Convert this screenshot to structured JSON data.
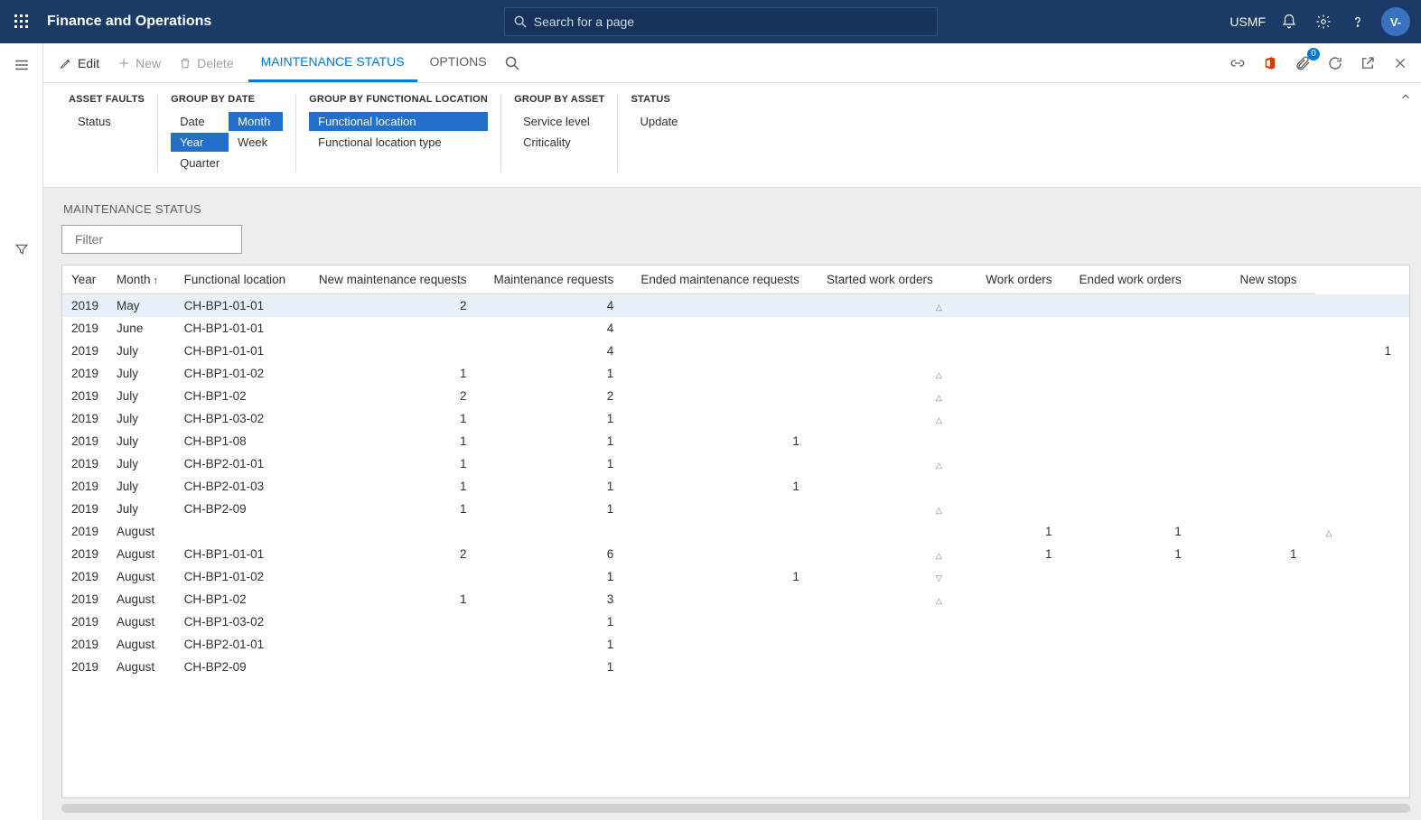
{
  "header": {
    "app_title": "Finance and Operations",
    "search_placeholder": "Search for a page",
    "company": "USMF",
    "avatar_initials": "V-"
  },
  "cmdbar": {
    "edit": "Edit",
    "new": "New",
    "delete": "Delete",
    "tabs": [
      "MAINTENANCE STATUS",
      "OPTIONS"
    ],
    "active_tab_index": 0,
    "attach_badge": "0"
  },
  "groups": {
    "asset_faults": {
      "title": "ASSET FAULTS",
      "items": [
        {
          "label": "Status",
          "selected": false
        }
      ]
    },
    "group_by_date": {
      "title": "GROUP BY DATE",
      "grid": [
        {
          "label": "Date",
          "selected": false
        },
        {
          "label": "Month",
          "selected": true
        },
        {
          "label": "Year",
          "selected": true
        },
        {
          "label": "Week",
          "selected": false
        },
        {
          "label": "Quarter",
          "selected": false
        }
      ]
    },
    "group_by_functional_location": {
      "title": "GROUP BY FUNCTIONAL LOCATION",
      "items": [
        {
          "label": "Functional location",
          "selected": true
        },
        {
          "label": "Functional location type",
          "selected": false
        }
      ]
    },
    "group_by_asset": {
      "title": "GROUP BY ASSET",
      "items": [
        {
          "label": "Service level",
          "selected": false
        },
        {
          "label": "Criticality",
          "selected": false
        }
      ]
    },
    "status": {
      "title": "STATUS",
      "items": [
        {
          "label": "Update",
          "selected": false
        }
      ]
    }
  },
  "section_title": "MAINTENANCE STATUS",
  "filter_placeholder": "Filter",
  "columns": [
    "Year",
    "Month",
    "Functional location",
    "New maintenance requests",
    "Maintenance requests",
    "Ended maintenance requests",
    "Started work orders",
    "Work orders",
    "Ended work orders",
    "New stops"
  ],
  "sort_col_index": 1,
  "rows": [
    {
      "year": "2019",
      "month": "May",
      "loc": "CH-BP1-01-01",
      "new_req": "2",
      "m_req": "4",
      "ended_req": "",
      "ended_ind": "up",
      "started_wo": "",
      "wo": "",
      "ended_wo": "",
      "ended_wo_ind": "",
      "stops": "",
      "selected": true
    },
    {
      "year": "2019",
      "month": "June",
      "loc": "CH-BP1-01-01",
      "new_req": "",
      "m_req": "4",
      "ended_req": "",
      "ended_ind": "",
      "started_wo": "",
      "wo": "",
      "ended_wo": "",
      "ended_wo_ind": "",
      "stops": ""
    },
    {
      "year": "2019",
      "month": "July",
      "loc": "CH-BP1-01-01",
      "new_req": "",
      "m_req": "4",
      "ended_req": "",
      "ended_ind": "",
      "started_wo": "",
      "wo": "",
      "ended_wo": "",
      "ended_wo_ind": "",
      "stops": "1"
    },
    {
      "year": "2019",
      "month": "July",
      "loc": "CH-BP1-01-02",
      "new_req": "1",
      "m_req": "1",
      "ended_req": "",
      "ended_ind": "up",
      "started_wo": "",
      "wo": "",
      "ended_wo": "",
      "ended_wo_ind": "",
      "stops": ""
    },
    {
      "year": "2019",
      "month": "July",
      "loc": "CH-BP1-02",
      "new_req": "2",
      "m_req": "2",
      "ended_req": "",
      "ended_ind": "up",
      "started_wo": "",
      "wo": "",
      "ended_wo": "",
      "ended_wo_ind": "",
      "stops": ""
    },
    {
      "year": "2019",
      "month": "July",
      "loc": "CH-BP1-03-02",
      "new_req": "1",
      "m_req": "1",
      "ended_req": "",
      "ended_ind": "up",
      "started_wo": "",
      "wo": "",
      "ended_wo": "",
      "ended_wo_ind": "",
      "stops": ""
    },
    {
      "year": "2019",
      "month": "July",
      "loc": "CH-BP1-08",
      "new_req": "1",
      "m_req": "1",
      "ended_req": "1",
      "ended_ind": "",
      "started_wo": "",
      "wo": "",
      "ended_wo": "",
      "ended_wo_ind": "",
      "stops": ""
    },
    {
      "year": "2019",
      "month": "July",
      "loc": "CH-BP2-01-01",
      "new_req": "1",
      "m_req": "1",
      "ended_req": "",
      "ended_ind": "up",
      "started_wo": "",
      "wo": "",
      "ended_wo": "",
      "ended_wo_ind": "",
      "stops": ""
    },
    {
      "year": "2019",
      "month": "July",
      "loc": "CH-BP2-01-03",
      "new_req": "1",
      "m_req": "1",
      "ended_req": "1",
      "ended_ind": "",
      "started_wo": "",
      "wo": "",
      "ended_wo": "",
      "ended_wo_ind": "",
      "stops": ""
    },
    {
      "year": "2019",
      "month": "July",
      "loc": "CH-BP2-09",
      "new_req": "1",
      "m_req": "1",
      "ended_req": "",
      "ended_ind": "up",
      "started_wo": "",
      "wo": "",
      "ended_wo": "",
      "ended_wo_ind": "",
      "stops": ""
    },
    {
      "year": "2019",
      "month": "August",
      "loc": "",
      "new_req": "",
      "m_req": "",
      "ended_req": "",
      "ended_ind": "",
      "started_wo": "1",
      "wo": "1",
      "ended_wo": "",
      "ended_wo_ind": "up",
      "stops": ""
    },
    {
      "year": "2019",
      "month": "August",
      "loc": "CH-BP1-01-01",
      "new_req": "2",
      "m_req": "6",
      "ended_req": "",
      "ended_ind": "up",
      "started_wo": "1",
      "wo": "1",
      "ended_wo": "1",
      "ended_wo_ind": "",
      "stops": ""
    },
    {
      "year": "2019",
      "month": "August",
      "loc": "CH-BP1-01-02",
      "new_req": "",
      "m_req": "1",
      "ended_req": "1",
      "ended_ind": "down",
      "started_wo": "",
      "wo": "",
      "ended_wo": "",
      "ended_wo_ind": "",
      "stops": ""
    },
    {
      "year": "2019",
      "month": "August",
      "loc": "CH-BP1-02",
      "new_req": "1",
      "m_req": "3",
      "ended_req": "",
      "ended_ind": "up",
      "started_wo": "",
      "wo": "",
      "ended_wo": "",
      "ended_wo_ind": "",
      "stops": ""
    },
    {
      "year": "2019",
      "month": "August",
      "loc": "CH-BP1-03-02",
      "new_req": "",
      "m_req": "1",
      "ended_req": "",
      "ended_ind": "",
      "started_wo": "",
      "wo": "",
      "ended_wo": "",
      "ended_wo_ind": "",
      "stops": ""
    },
    {
      "year": "2019",
      "month": "August",
      "loc": "CH-BP2-01-01",
      "new_req": "",
      "m_req": "1",
      "ended_req": "",
      "ended_ind": "",
      "started_wo": "",
      "wo": "",
      "ended_wo": "",
      "ended_wo_ind": "",
      "stops": ""
    },
    {
      "year": "2019",
      "month": "August",
      "loc": "CH-BP2-09",
      "new_req": "",
      "m_req": "1",
      "ended_req": "",
      "ended_ind": "",
      "started_wo": "",
      "wo": "",
      "ended_wo": "",
      "ended_wo_ind": "",
      "stops": ""
    }
  ]
}
